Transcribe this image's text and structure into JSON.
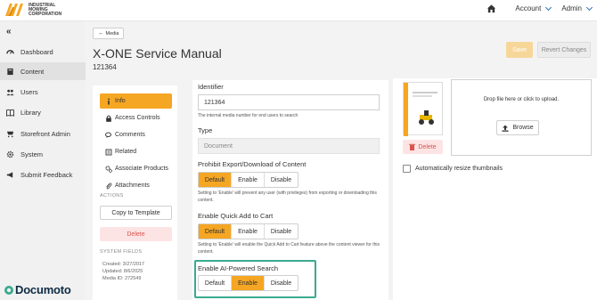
{
  "header": {
    "logo_text": "INDUSTRIAL MOWING CORPORATION",
    "account_label": "Account",
    "admin_label": "Admin"
  },
  "sidebar": {
    "collapse_glyph": "«",
    "items": [
      {
        "label": "Dashboard",
        "icon": "dashboard-icon"
      },
      {
        "label": "Content",
        "icon": "book-icon"
      },
      {
        "label": "Users",
        "icon": "users-icon"
      },
      {
        "label": "Library",
        "icon": "library-icon"
      },
      {
        "label": "Storefront Admin",
        "icon": "storefront-icon"
      },
      {
        "label": "System",
        "icon": "gear-icon"
      },
      {
        "label": "Submit Feedback",
        "icon": "megaphone-icon"
      }
    ],
    "brand": "Documoto"
  },
  "page": {
    "back_label": "Media",
    "title": "X-ONE Service Manual",
    "subtitle": "121364",
    "save_label": "Save",
    "revert_label": "Revert Changes"
  },
  "left_menu": {
    "items": [
      {
        "label": "Info",
        "icon": "info-icon"
      },
      {
        "label": "Access Controls",
        "icon": "lock-icon"
      },
      {
        "label": "Comments",
        "icon": "comments-icon"
      },
      {
        "label": "Related",
        "icon": "related-icon"
      },
      {
        "label": "Associate Products",
        "icon": "gears-icon"
      },
      {
        "label": "Attachments",
        "icon": "paperclip-icon"
      }
    ],
    "actions_label": "ACTIONS",
    "copy_label": "Copy to Template",
    "delete_label": "Delete",
    "system_fields_label": "SYSTEM FIELDS",
    "created": "Created: 3/27/2017",
    "updated": "Updated: 8/6/2025",
    "media_id": "Media ID: 272549"
  },
  "form": {
    "identifier_label": "Identifier",
    "identifier_value": "121364",
    "identifier_help": "The internal media number for end users to search",
    "type_label": "Type",
    "type_value": "Document",
    "export_label": "Prohibit Export/Download of Content",
    "export_options": [
      "Default",
      "Enable",
      "Disable"
    ],
    "export_selected": "Default",
    "export_help": "Setting to 'Enable' will prevent any user (with privileges) from exporting or downloading this content.",
    "cart_label": "Enable Quick Add to Cart",
    "cart_options": [
      "Default",
      "Enable",
      "Disable"
    ],
    "cart_selected": "Default",
    "cart_help": "Setting to 'Enable' will enable the Quick Add to Cart feature above the content viewer for this content.",
    "ai_label": "Enable AI-Powered Search",
    "ai_options": [
      "Default",
      "Enable",
      "Disable"
    ],
    "ai_selected": "Enable"
  },
  "thumbnail": {
    "delete_label": "Delete",
    "drop_text": "Drop file here or click to upload.",
    "browse_label": "Browse",
    "resize_label": "Automatically resize thumbnails",
    "resize_checked": false
  },
  "colors": {
    "accent": "#f5a623",
    "highlight": "#3aaa8f",
    "danger": "#d9534f",
    "link": "#2f6fb0"
  }
}
